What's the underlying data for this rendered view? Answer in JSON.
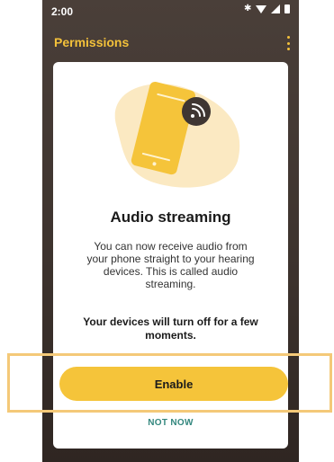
{
  "status": {
    "time": "2:00",
    "icons": [
      "bluetooth-icon",
      "wifi-icon",
      "signal-icon",
      "battery-icon"
    ]
  },
  "appbar": {
    "title": "Permissions",
    "menu_icon": "more-vert-icon"
  },
  "card": {
    "illustration": "phone-streaming-icon",
    "title": "Audio streaming",
    "body": "You can now receive audio from your phone straight to your hearing devices. This is called audio streaming.",
    "warning": "Your devices will turn off for a few moments."
  },
  "actions": {
    "enable_label": "Enable",
    "not_now_label": "NOT NOW"
  },
  "colors": {
    "accent": "#f5c43a",
    "title_accent": "#f3c13a",
    "link": "#33877e",
    "highlight_frame": "#f4c978",
    "background": "#3c322d"
  }
}
